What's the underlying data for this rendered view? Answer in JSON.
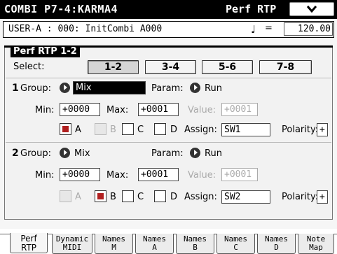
{
  "header": {
    "title": "COMBI P7-4:KARMA4",
    "mode": "Perf RTP",
    "menu_icon": "chevron-down-icon"
  },
  "program": {
    "name": "USER-A : 000: InitCombi  A000",
    "tempo_icon": "quarter-note-icon",
    "tempo_symbol": "♩",
    "tempo_eq": "=",
    "tempo": "120.00"
  },
  "panel": {
    "title": "Perf RTP 1-2",
    "select_label": "Select:",
    "select_options": [
      "1-2",
      "3-4",
      "5-6",
      "7-8"
    ],
    "selected": "1-2"
  },
  "rows": [
    {
      "number": "1",
      "group_label": "Group:",
      "group_value": "Mix",
      "param_label": "Param:",
      "param_value": "Run",
      "min_label": "Min:",
      "min_value": "+0000",
      "max_label": "Max:",
      "max_value": "+0001",
      "value_label": "Value:",
      "value_value": "+0001",
      "checks": [
        {
          "label": "A",
          "checked": true,
          "enabled": true
        },
        {
          "label": "B",
          "checked": false,
          "enabled": false
        },
        {
          "label": "C",
          "checked": false,
          "enabled": true
        },
        {
          "label": "D",
          "checked": false,
          "enabled": true
        }
      ],
      "assign_label": "Assign:",
      "assign_value": "SW1",
      "polarity_label": "Polarity:",
      "polarity_value": "+"
    },
    {
      "number": "2",
      "group_label": "Group:",
      "group_value": "Mix",
      "param_label": "Param:",
      "param_value": "Run",
      "min_label": "Min:",
      "min_value": "+0000",
      "max_label": "Max:",
      "max_value": "+0001",
      "value_label": "Value:",
      "value_value": "+0001",
      "checks": [
        {
          "label": "A",
          "checked": false,
          "enabled": false
        },
        {
          "label": "B",
          "checked": true,
          "enabled": true
        },
        {
          "label": "C",
          "checked": false,
          "enabled": true
        },
        {
          "label": "D",
          "checked": false,
          "enabled": true
        }
      ],
      "assign_label": "Assign:",
      "assign_value": "SW2",
      "polarity_label": "Polarity:",
      "polarity_value": "+"
    }
  ],
  "tabs": [
    {
      "line1": "Perf",
      "line2": "RTP",
      "active": true
    },
    {
      "line1": "Dynamic",
      "line2": "MIDI",
      "active": false
    },
    {
      "line1": "Names",
      "line2": "M",
      "active": false
    },
    {
      "line1": "Names",
      "line2": "A",
      "active": false
    },
    {
      "line1": "Names",
      "line2": "B",
      "active": false
    },
    {
      "line1": "Names",
      "line2": "C",
      "active": false
    },
    {
      "line1": "Names",
      "line2": "D",
      "active": false
    },
    {
      "line1": "Note",
      "line2": "Map",
      "active": false
    }
  ],
  "colors": {
    "checked_fill": "#b12020",
    "title_bar": "#000000"
  }
}
